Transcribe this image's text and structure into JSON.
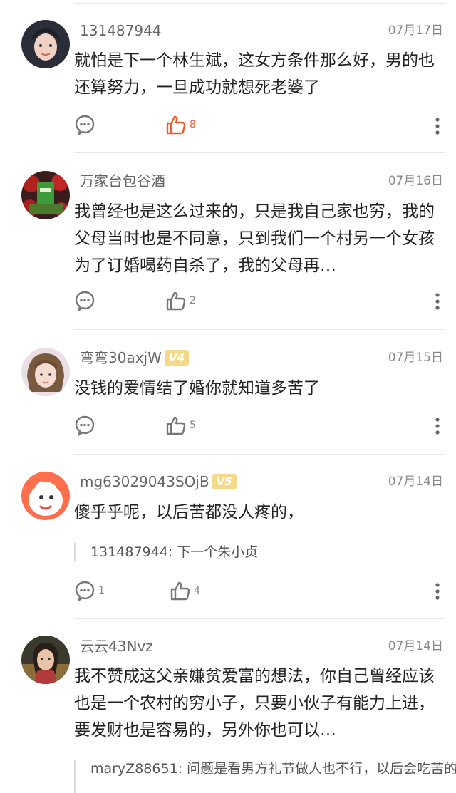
{
  "comments": [
    {
      "user": "131487944",
      "date": "07月17日",
      "text": "就怕是下一个林生斌，这女方条件那么好，男的也还算努力，一旦成功就想死老婆了",
      "reply_count": "",
      "like_count": "8",
      "liked": true
    },
    {
      "user": "万家台包谷酒",
      "date": "07月16日",
      "text": "我曾经也是这么过来的，只是我自己家也穷，我的父母当时也是不同意，只到我们一个村另一个女孩为了订婚喝药自杀了，我的父母再…",
      "reply_count": "",
      "like_count": "2",
      "liked": false
    },
    {
      "user": "弯弯30axjW",
      "badge": "V4",
      "date": "07月15日",
      "text": "没钱的爱情结了婚你就知道多苦了",
      "reply_count": "",
      "like_count": "5",
      "liked": false
    },
    {
      "user": "mg63029043SOjB",
      "badge": "V5",
      "date": "07月14日",
      "text": "傻乎乎呢，以后苦都没人疼的，",
      "quote": "131487944: 下一个朱小贞",
      "reply_count": "1",
      "like_count": "4",
      "liked": false
    },
    {
      "user": "云云43Nvz",
      "date": "07月14日",
      "text": "我不赞成这父亲嫌贫爱富的想法，你自己曾经应该也是一个农村的穷小子，只要小伙子有能力上进，要发财也是容易的，另外你也可以…",
      "quote": "maryZ88651: 问题是看男方礼节做人也不行，以后会吃苦的",
      "reply_count": "",
      "like_count": "",
      "liked": false
    }
  ],
  "colors": {
    "like_active": "#f05a28",
    "icon": "#777777",
    "badge_bg": "#f4d98a"
  },
  "icons": [
    "comment-bubble-icon",
    "thumbs-up-icon",
    "more-vertical-icon"
  ]
}
